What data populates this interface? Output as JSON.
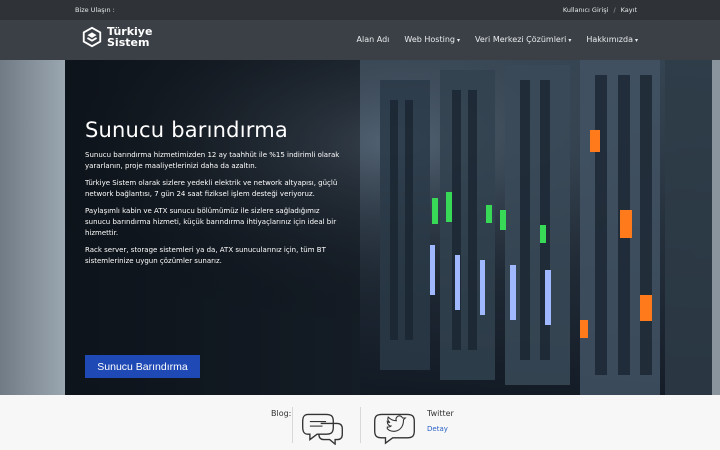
{
  "topbar": {
    "contact": "Bize Ulaşın :",
    "login": "Kullanıcı Girişi",
    "separator": "/",
    "register": "Kayıt"
  },
  "brand": {
    "line1": "Türkiye",
    "line2": "Sistem",
    "logo_icon": "hexagon-logo-icon"
  },
  "nav": {
    "items": [
      {
        "label": "Alan Adı",
        "caret": ""
      },
      {
        "label": "Web Hosting",
        "caret": "▾"
      },
      {
        "label": "Veri Merkezi Çözümleri",
        "caret": "▾"
      },
      {
        "label": "Hakkımızda",
        "caret": "▾"
      }
    ]
  },
  "hero": {
    "title": "Sunucu barındırma",
    "paragraphs": [
      "Sunucu barındırma hizmetimizden 12 ay taahhüt ile %15 indirimli olarak yararlanın, proje maaliyetlerinizi daha da azaltın.",
      "Türkiye Sistem olarak sizlere yedekli elektrik ve network altyapısı, güçlü network bağlantısı, 7 gün 24 saat fiziksel işlem desteği veriyoruz.",
      "Paylaşımlı kabin ve ATX sunucu bölümümüz ile sizlere sağladığımız sunucu barındırma hizmeti, küçük barındırma ihtiyaçlarınız için ideal bir hizmettir.",
      "Rack server, storage sistemleri ya da, ATX sunucularınız için, tüm BT sistemlerinize uygun çözümler sunarız."
    ],
    "cta": "Sunucu Barındırma",
    "slides": [
      {
        "active": true
      },
      {
        "active": false
      }
    ]
  },
  "bottom": {
    "blog_label": "Blog:",
    "twitter_label": "Twitter",
    "twitter_link": "Detay",
    "icons": [
      "chat-bubble-icon",
      "twitter-bird-icon"
    ]
  },
  "colors": {
    "topbar": "#2f3338",
    "navbar": "#3b4046",
    "cta": "#1f49b4",
    "link": "#2a62c7",
    "led_green": "#38d957",
    "led_orange": "#ff7a1a",
    "led_blue": "#9fb8ff"
  }
}
